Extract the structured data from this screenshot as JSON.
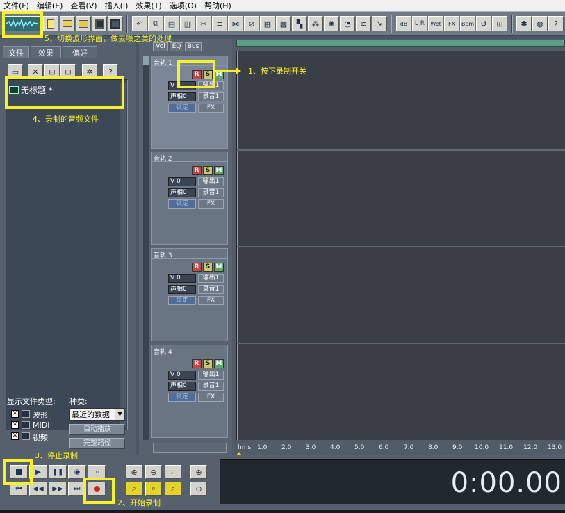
{
  "menu": [
    "文件(F)",
    "编辑(E)",
    "查看(V)",
    "插入(I)",
    "效果(T)",
    "选项(O)",
    "帮助(H)"
  ],
  "toolbar": {
    "icons": [
      "waveform-view-icon",
      "new-file-icon",
      "open-file-icon",
      "open-append-icon",
      "save-icon",
      "save-all-icon",
      "undo-icon",
      "copy-icon",
      "cut-icon",
      "paste-icon",
      "mix-paste-icon",
      "trim-icon",
      "envelope-icon",
      "silence-icon",
      "insert-silence-icon",
      "convert-icon",
      "noise-reduction-icon",
      "filter-icon",
      "amplify-icon",
      "normalize-icon",
      "dynamics-icon",
      "fade-icon",
      "echo-icon",
      "reverb-icon",
      "stretch-icon",
      "db-icon",
      "pan-icon",
      "wet-icon",
      "fx-icon",
      "bpm-icon",
      "loop-icon",
      "marker-icon",
      "properties-icon",
      "record-settings-icon",
      "help-icon"
    ],
    "wet_label": "Wet",
    "fx_label": "FX",
    "bpm_label": "Bpm",
    "db_label": "dB"
  },
  "left_panel": {
    "tabs": [
      "文件",
      "效果",
      "偏好"
    ],
    "file_item": "无标题 *",
    "show_types_label": "显示文件类型:",
    "kind_label": "种类:",
    "types": [
      "波形",
      "MIDI",
      "视频"
    ],
    "kind_value": "最近的数据",
    "auto_play": "自动播放",
    "full_path": "完整路径"
  },
  "tracks_col": {
    "tabs": [
      "Vol",
      "EQ",
      "Bus"
    ],
    "tracks": [
      {
        "name": "音轨 1",
        "vol": "V 0",
        "pan": "声相0",
        "out": "输出1",
        "rec": "录音1",
        "lock": "锁定",
        "fx": "FX"
      },
      {
        "name": "音轨 2",
        "vol": "V 0",
        "pan": "声相0",
        "out": "输出1",
        "rec": "录音1",
        "lock": "锁定",
        "fx": "FX"
      },
      {
        "name": "音轨 3",
        "vol": "V 0",
        "pan": "声相0",
        "out": "输出1",
        "rec": "录音1",
        "lock": "锁定",
        "fx": "FX"
      },
      {
        "name": "音轨 4",
        "vol": "V 0",
        "pan": "声相0",
        "out": "输出1",
        "rec": "录音1",
        "lock": "锁定",
        "fx": "FX"
      }
    ],
    "rsm": [
      "R",
      "S",
      "M"
    ]
  },
  "ruler": [
    "hms",
    "1.0",
    "2.0",
    "3.0",
    "4.0",
    "5.0",
    "6.0",
    "7.0",
    "8.0",
    "9.0",
    "10.0",
    "11.0",
    "12.0",
    "13.0"
  ],
  "time_display": "0:00.00",
  "annotations": {
    "a1": "1、按下录制开关",
    "a2": "2、开始录制",
    "a3": "3、停止录制",
    "a4": "4、录制的音频文件",
    "a5": "5、切换波形界面，做去噪之类的处理"
  },
  "colors": {
    "highlight": "#f7f12a",
    "record": "#cc2222",
    "background": "#4a5565"
  }
}
